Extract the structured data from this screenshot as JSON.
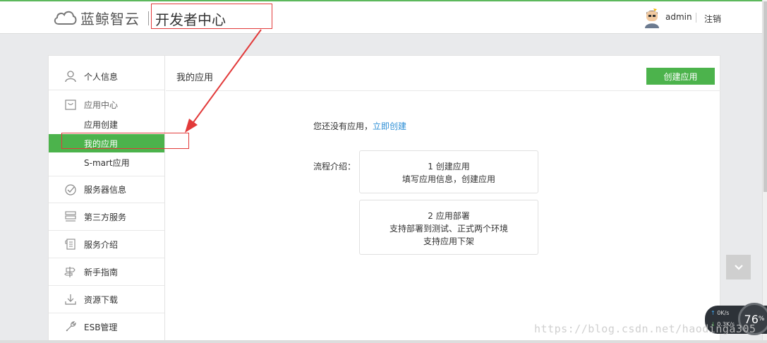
{
  "header": {
    "brand": "蓝鲸智云",
    "subtitle": "开发者中心",
    "username": "admin",
    "logout_label": "注销"
  },
  "sidebar": {
    "personal_info": "个人信息",
    "app_center": "应用中心",
    "sub_items": [
      "应用创建",
      "我的应用",
      "S-mart应用"
    ],
    "items": [
      "服务器信息",
      "第三方服务",
      "服务介绍",
      "新手指南",
      "资源下载",
      "ESB管理"
    ]
  },
  "content": {
    "page_title": "我的应用",
    "create_button": "创建应用",
    "empty_text": "您还没有应用，",
    "empty_link": "立即创建",
    "flow_label": "流程介绍：",
    "steps": [
      {
        "title": "1 创建应用",
        "lines": [
          "填写应用信息，创建应用"
        ]
      },
      {
        "title": "2 应用部署",
        "lines": [
          "支持部署到测试、正式两个环境",
          "支持应用下架"
        ]
      }
    ]
  },
  "net_widget": {
    "upload": "0K/s",
    "download": "0.3K/s",
    "percent": "76",
    "percent_unit": "%"
  },
  "watermark": "https://blog.csdn.net/haodinga305"
}
